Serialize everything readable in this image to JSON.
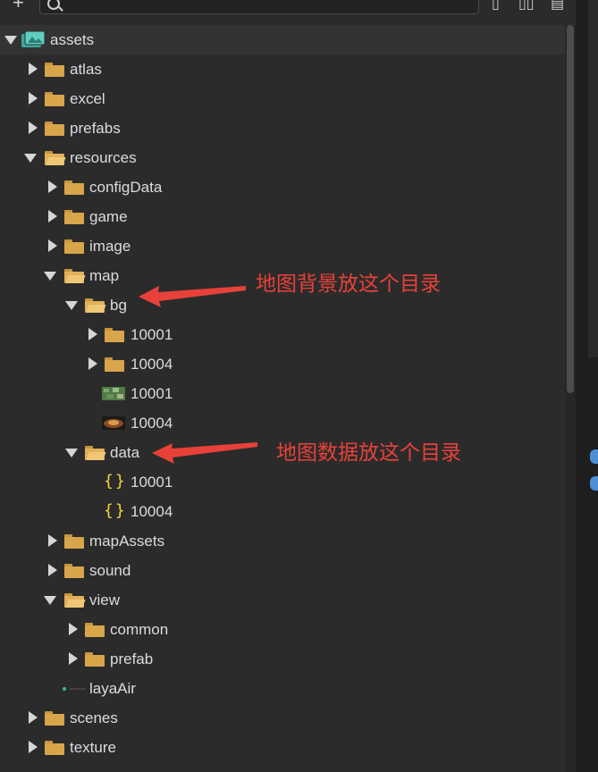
{
  "toolbar": {
    "add_icon": "plus-icon",
    "search_icon": "search-icon"
  },
  "tree": {
    "root": "assets",
    "items": [
      {
        "label": "atlas"
      },
      {
        "label": "excel"
      },
      {
        "label": "prefabs"
      },
      {
        "label": "resources"
      },
      {
        "label": "configData"
      },
      {
        "label": "game"
      },
      {
        "label": "image"
      },
      {
        "label": "map"
      },
      {
        "label": "bg"
      },
      {
        "label": "10001"
      },
      {
        "label": "10004"
      },
      {
        "label": "10001"
      },
      {
        "label": "10004"
      },
      {
        "label": "data"
      },
      {
        "label": "10001"
      },
      {
        "label": "10004"
      },
      {
        "label": "mapAssets"
      },
      {
        "label": "sound"
      },
      {
        "label": "view"
      },
      {
        "label": "common"
      },
      {
        "label": "prefab"
      },
      {
        "label": "layaAir"
      },
      {
        "label": "scenes"
      },
      {
        "label": "texture"
      }
    ]
  },
  "annotations": {
    "bg_note": "地图背景放这个目录",
    "data_note": "地图数据放这个目录"
  },
  "colors": {
    "annotation": "#e8413a",
    "folder": "#d9a54a",
    "json": "#f2d33c"
  }
}
